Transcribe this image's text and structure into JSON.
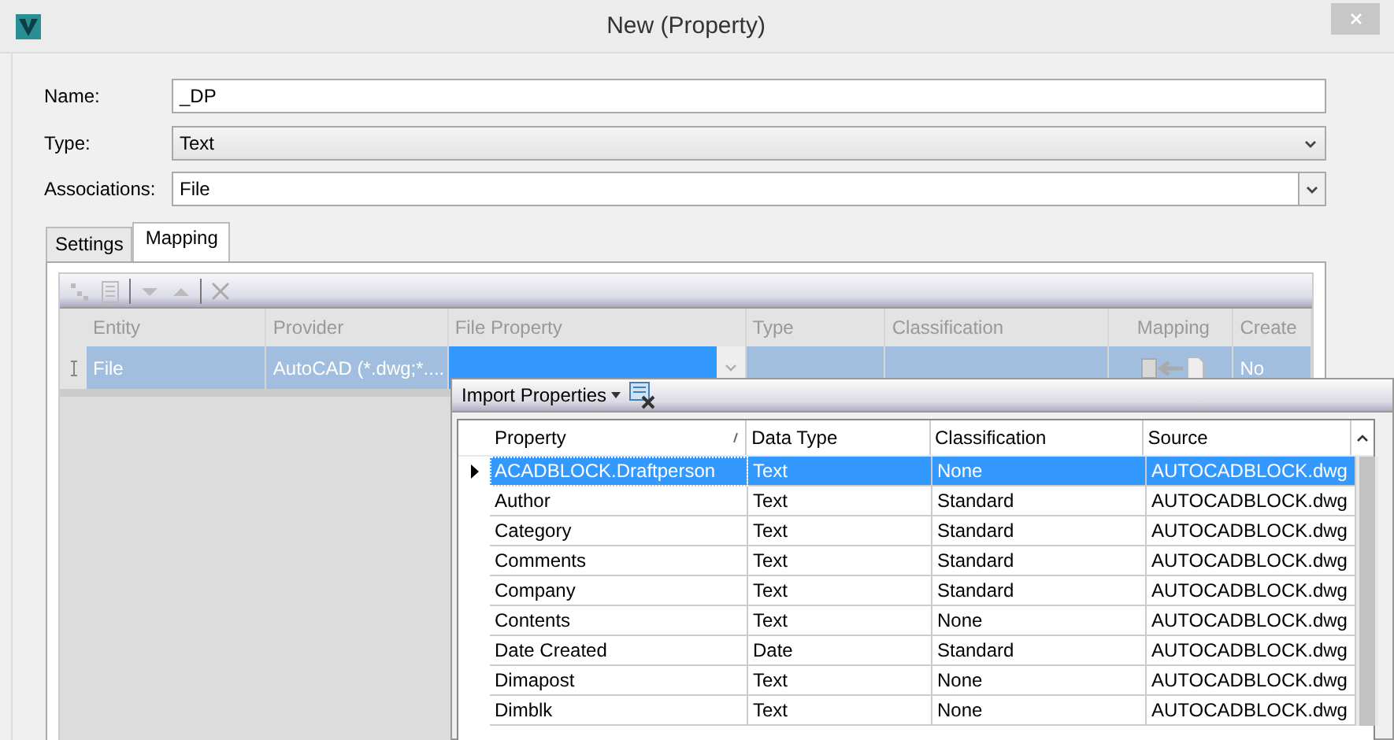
{
  "window": {
    "title": "New (Property)"
  },
  "fields": [
    {
      "label": "Name:",
      "kind": "text",
      "value": "_DP"
    },
    {
      "label": "Type:",
      "kind": "dropdown",
      "value": "Text"
    },
    {
      "label": "Associations:",
      "kind": "combo",
      "value": "File"
    }
  ],
  "tabs": [
    {
      "label": "Settings",
      "selected": false
    },
    {
      "label": "Mapping",
      "selected": true
    }
  ],
  "mapping": {
    "columns": [
      "Entity",
      "Provider",
      "File Property",
      "Type",
      "Classification",
      "Mapping",
      "Create"
    ],
    "rows": [
      {
        "entity": "File",
        "provider": "AutoCAD (*.dwg;*....",
        "file_property": "",
        "type": "",
        "classification": "",
        "create": "No",
        "selected": true
      }
    ]
  },
  "import_popup": {
    "menu": "Import Properties",
    "columns": [
      "Property",
      "Data Type",
      "Classification",
      "Source"
    ],
    "rows": [
      {
        "property": "ACADBLOCK.Draftperson",
        "data_type": "Text",
        "classification": "None",
        "source": "AUTOCADBLOCK.dwg",
        "selected": true
      },
      {
        "property": "Author",
        "data_type": "Text",
        "classification": "Standard",
        "source": "AUTOCADBLOCK.dwg",
        "selected": false
      },
      {
        "property": "Category",
        "data_type": "Text",
        "classification": "Standard",
        "source": "AUTOCADBLOCK.dwg",
        "selected": false
      },
      {
        "property": "Comments",
        "data_type": "Text",
        "classification": "Standard",
        "source": "AUTOCADBLOCK.dwg",
        "selected": false
      },
      {
        "property": "Company",
        "data_type": "Text",
        "classification": "Standard",
        "source": "AUTOCADBLOCK.dwg",
        "selected": false
      },
      {
        "property": "Contents",
        "data_type": "Text",
        "classification": "None",
        "source": "AUTOCADBLOCK.dwg",
        "selected": false
      },
      {
        "property": "Date Created",
        "data_type": "Date",
        "classification": "Standard",
        "source": "AUTOCADBLOCK.dwg",
        "selected": false
      },
      {
        "property": "Dimapost",
        "data_type": "Text",
        "classification": "None",
        "source": "AUTOCADBLOCK.dwg",
        "selected": false
      },
      {
        "property": "Dimblk",
        "data_type": "Text",
        "classification": "None",
        "source": "AUTOCADBLOCK.dwg",
        "selected": false
      }
    ]
  }
}
